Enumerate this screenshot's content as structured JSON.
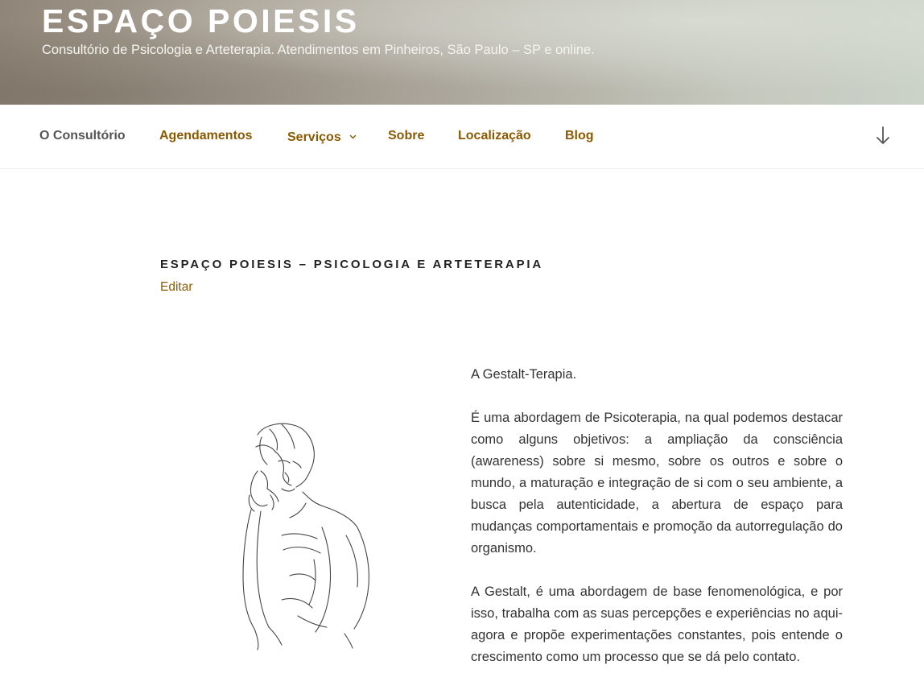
{
  "header": {
    "site_title": "ESPAÇO POIESIS",
    "site_description": "Consultório de Psicologia e Arteterapia. Atendimentos em Pinheiros, São Paulo – SP e online."
  },
  "nav": {
    "items": [
      {
        "label": "O Consultório",
        "current": true
      },
      {
        "label": "Agendamentos"
      },
      {
        "label": "Serviços",
        "has_submenu": true
      },
      {
        "label": "Sobre"
      },
      {
        "label": "Localização"
      },
      {
        "label": "Blog"
      }
    ],
    "scroll_icon": "arrow-down-icon",
    "link_color": "#8a5a00"
  },
  "entry": {
    "title": "ESPAÇO POIESIS – PSICOLOGIA E ARTETERAPIA",
    "edit_label": "Editar",
    "image": "line-drawing-pensive-man",
    "paragraphs": [
      "A Gestalt-Terapia.",
      "É uma abordagem de Psicoterapia, na qual podemos destacar como alguns objetivos: a ampliação da consciência (awareness) sobre si mesmo, sobre os outros e sobre o mundo, a maturação e integração de si com o seu ambiente, a busca pela autenticidade, a abertura de espaço para mudanças comportamentais e promoção da autorregulação do organismo.",
      "A Gestalt, é uma abordagem de base fenomenológica, e por isso, trabalha com as suas percepções e experiências no aqui-agora e propõe experimentações constantes, pois entende o crescimento como um processo que se dá pelo contato."
    ]
  }
}
